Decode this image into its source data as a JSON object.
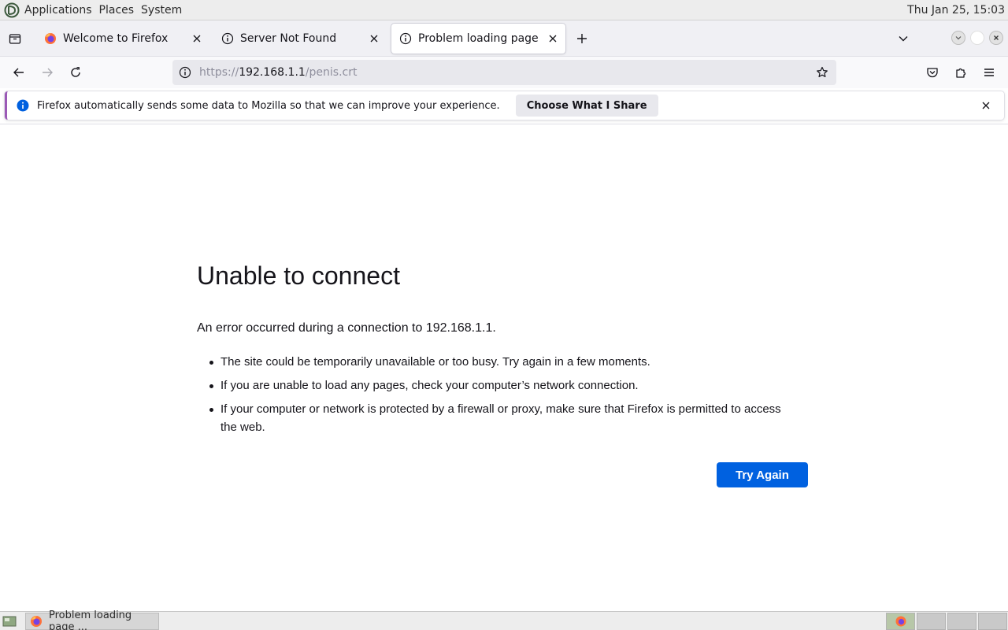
{
  "system_panel": {
    "menus": [
      "Applications",
      "Places",
      "System"
    ],
    "clock": "Thu Jan 25, 15:03"
  },
  "tabs": [
    {
      "title": "Welcome to Firefox",
      "icon": "firefox-icon",
      "active": false
    },
    {
      "title": "Server Not Found",
      "icon": "info-icon",
      "active": false
    },
    {
      "title": "Problem loading page",
      "icon": "info-icon",
      "active": true
    }
  ],
  "urlbar": {
    "scheme": "https://",
    "host": "192.168.1.1",
    "path": "/penis.crt"
  },
  "notification": {
    "text": "Firefox automatically sends some data to Mozilla so that we can improve your experience.",
    "button_label": "Choose What I Share"
  },
  "error_page": {
    "title": "Unable to connect",
    "intro": "An error occurred during a connection to 192.168.1.1.",
    "bullets": [
      "The site could be temporarily unavailable or too busy. Try again in a few moments.",
      "If you are unable to load any pages, check your computer’s network connection.",
      "If your computer or network is protected by a firewall or proxy, make sure that Firefox is permitted to access the web."
    ],
    "try_again_label": "Try Again"
  },
  "taskbar": {
    "window_label": "Problem loading page ..."
  },
  "colors": {
    "accent_button": "#0061e0",
    "info_blue": "#0060df"
  }
}
